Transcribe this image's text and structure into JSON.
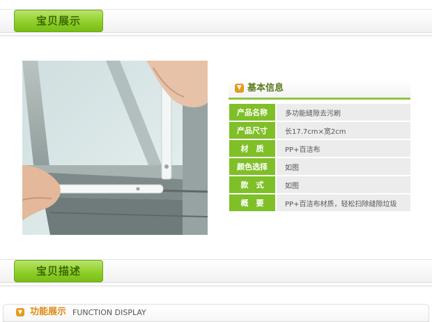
{
  "sections": {
    "display_label": "宝贝展示",
    "description_label": "宝贝描述"
  },
  "product_image": {
    "alt": "window frame cleaning brush"
  },
  "info": {
    "title": "基本信息",
    "rows": [
      {
        "label": "产品名称",
        "value": "多功能缝隙去污刷"
      },
      {
        "label": "产品尺寸",
        "value": "长17.7cm×宽2cm"
      },
      {
        "label": "材　质",
        "value": "PP+百洁布"
      },
      {
        "label": "颜色选择",
        "value": "如图"
      },
      {
        "label": "款　式",
        "value": "如图"
      },
      {
        "label": "概　要",
        "value": "PP+百洁布材质，轻松扫除缝隙垃圾"
      }
    ]
  },
  "function_display": {
    "title": "功能展示",
    "subtitle": "FUNCTION DISPLAY"
  },
  "colors": {
    "accent_green": "#8dc63f",
    "label_green": "#7fbf28",
    "icon_orange": "#e69a1d"
  }
}
